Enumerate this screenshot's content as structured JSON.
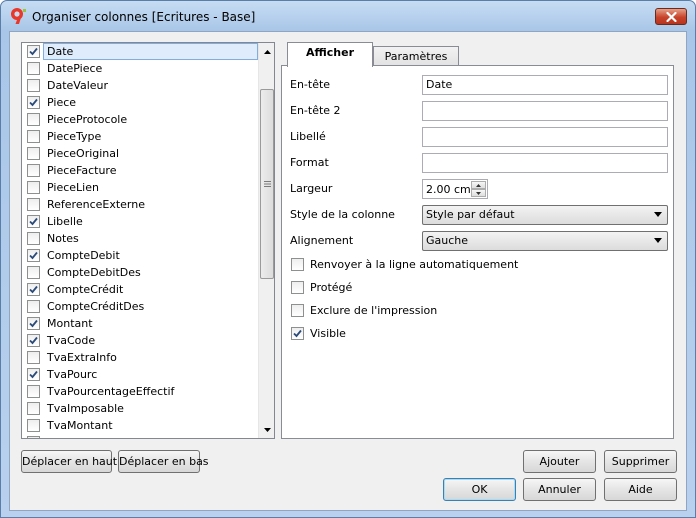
{
  "window": {
    "title": "Organiser colonnes [Ecritures - Base]",
    "icon": "app-9-icon"
  },
  "fields": [
    {
      "label": "Date",
      "checked": true,
      "selected": true
    },
    {
      "label": "DatePiece",
      "checked": false
    },
    {
      "label": "DateValeur",
      "checked": false
    },
    {
      "label": "Piece",
      "checked": true
    },
    {
      "label": "PieceProtocole",
      "checked": false
    },
    {
      "label": "PieceType",
      "checked": false
    },
    {
      "label": "PieceOriginal",
      "checked": false
    },
    {
      "label": "PieceFacture",
      "checked": false
    },
    {
      "label": "PieceLien",
      "checked": false
    },
    {
      "label": "ReferenceExterne",
      "checked": false
    },
    {
      "label": "Libelle",
      "checked": true
    },
    {
      "label": "Notes",
      "checked": false
    },
    {
      "label": "CompteDebit",
      "checked": true
    },
    {
      "label": "CompteDebitDes",
      "checked": false
    },
    {
      "label": "CompteCrédit",
      "checked": true
    },
    {
      "label": "CompteCréditDes",
      "checked": false
    },
    {
      "label": "Montant",
      "checked": true
    },
    {
      "label": "TvaCode",
      "checked": true
    },
    {
      "label": "TvaExtraInfo",
      "checked": false
    },
    {
      "label": "TvaPourc",
      "checked": true
    },
    {
      "label": "TvaPourcentageEffectif",
      "checked": false
    },
    {
      "label": "TvaImposable",
      "checked": false
    },
    {
      "label": "TvaMontant",
      "checked": false
    },
    {
      "label": "TvaCompte",
      "checked": false
    }
  ],
  "tabs": [
    {
      "label": "Afficher",
      "active": true
    },
    {
      "label": "Paramètres",
      "active": false
    }
  ],
  "form": {
    "entete_label": "En-tête",
    "entete_value": "Date",
    "entete2_label": "En-tête 2",
    "entete2_value": "",
    "libelle_label": "Libellé",
    "libelle_value": "",
    "format_label": "Format",
    "format_value": "",
    "largeur_label": "Largeur",
    "largeur_value": "2.00 cm",
    "style_label": "Style de la colonne",
    "style_value": "Style par défaut",
    "align_label": "Alignement",
    "align_value": "Gauche"
  },
  "options": [
    {
      "label": "Renvoyer à la ligne automatiquement",
      "checked": false
    },
    {
      "label": "Protégé",
      "checked": false
    },
    {
      "label": "Exclure de l'impression",
      "checked": false
    },
    {
      "label": "Visible",
      "checked": true
    }
  ],
  "buttons": {
    "move_up": "Déplacer en haut",
    "move_down": "Déplacer en bas",
    "add": "Ajouter",
    "delete": "Supprimer",
    "ok": "OK",
    "cancel": "Annuler",
    "help": "Aide"
  }
}
